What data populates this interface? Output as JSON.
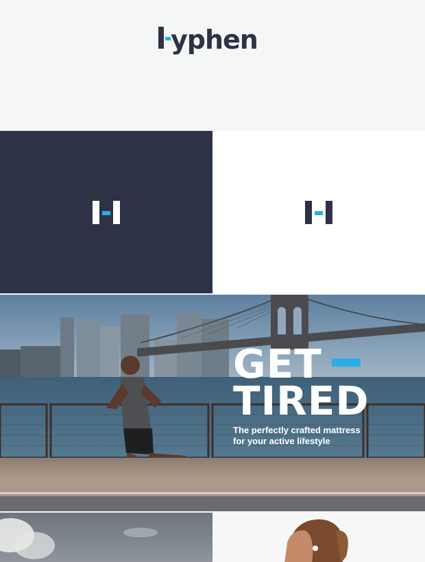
{
  "brand": {
    "wordmark_text": "yphen",
    "logo_name": "Hyphen"
  },
  "hero": {
    "headline_line1": "GET",
    "headline_line2": "TIRED",
    "subline_1": "The perfectly crafted mattress",
    "subline_2": "for your active lifestyle"
  },
  "colors": {
    "navy": "#2d3247",
    "accent": "#29aee6",
    "white": "#ffffff",
    "light_bg": "#f5f6f6"
  }
}
